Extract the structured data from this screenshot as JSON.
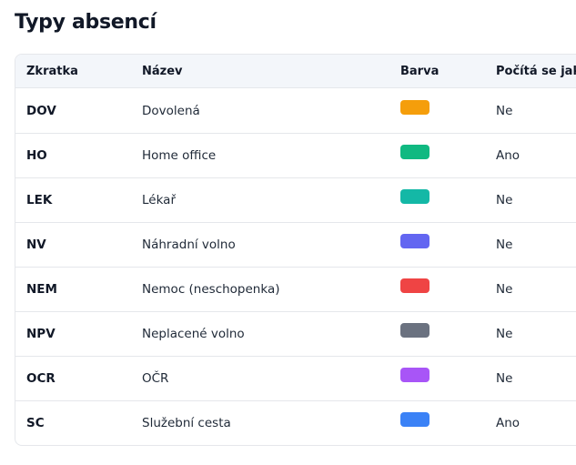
{
  "page": {
    "title": "Typy absencí"
  },
  "table": {
    "headers": {
      "code": "Zkratka",
      "name": "Název",
      "color": "Barva",
      "counts": "Počítá se jako"
    },
    "rows": [
      {
        "code": "DOV",
        "name": "Dovolená",
        "color": "#f59e0b",
        "counts": "Ne"
      },
      {
        "code": "HO",
        "name": "Home office",
        "color": "#10b981",
        "counts": "Ano"
      },
      {
        "code": "LEK",
        "name": "Lékař",
        "color": "#14b8a6",
        "counts": "Ne"
      },
      {
        "code": "NV",
        "name": "Náhradní volno",
        "color": "#6366f1",
        "counts": "Ne"
      },
      {
        "code": "NEM",
        "name": "Nemoc (neschopenka)",
        "color": "#ef4444",
        "counts": "Ne"
      },
      {
        "code": "NPV",
        "name": "Neplacené volno",
        "color": "#6b7280",
        "counts": "Ne"
      },
      {
        "code": "OCR",
        "name": "OČR",
        "color": "#a855f7",
        "counts": "Ne"
      },
      {
        "code": "SC",
        "name": "Služební cesta",
        "color": "#3b82f6",
        "counts": "Ano"
      }
    ]
  }
}
